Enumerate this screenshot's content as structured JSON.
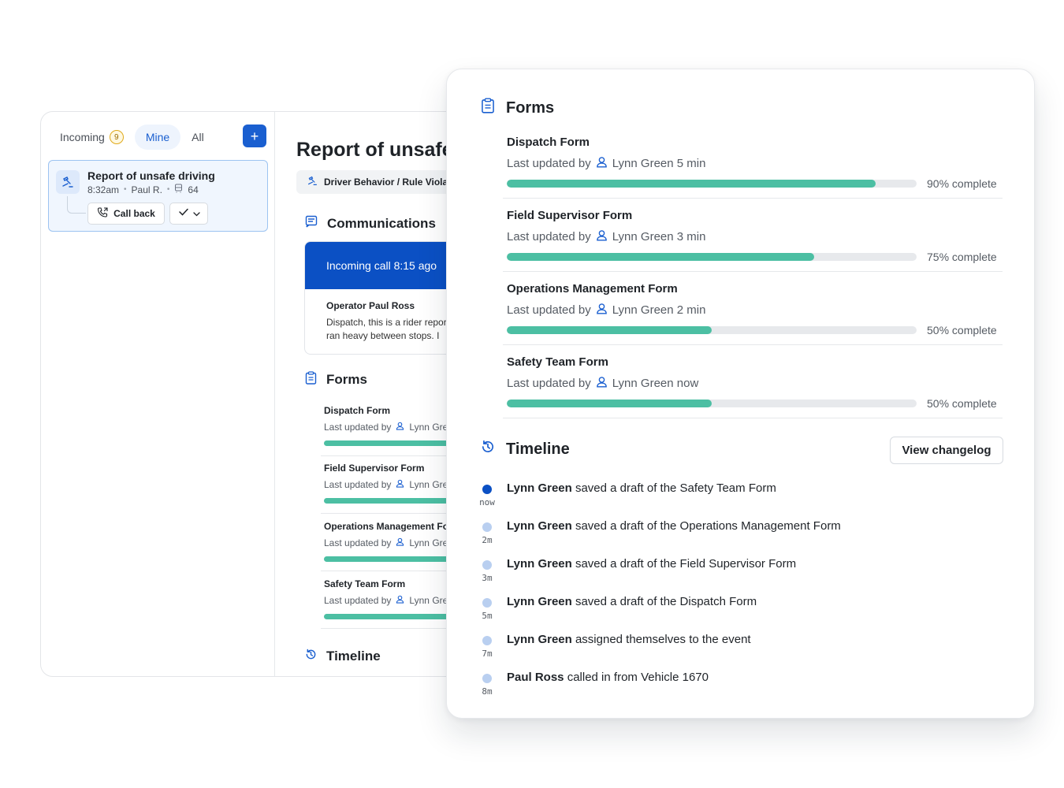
{
  "inbox": {
    "tabs": [
      {
        "label": "Incoming",
        "badge": "9"
      },
      {
        "label": "Mine"
      },
      {
        "label": "All"
      }
    ],
    "add_label": "+",
    "ticket": {
      "title": "Report of unsafe driving",
      "time": "8:32am",
      "operator": "Paul R.",
      "vehicle": "64",
      "callback_label": "Call back"
    }
  },
  "detail": {
    "title": "Report of unsafe driving",
    "category": "Driver Behavior / Rule Violation",
    "communications_heading": "Communications",
    "call_label": "Incoming call 8:15 ago",
    "operator": "Operator Paul Ross",
    "message_line1": "Dispatch, this is a rider report:",
    "message_line2": "ran heavy between stops. I",
    "forms_heading": "Forms",
    "timeline_heading": "Timeline",
    "forms": [
      {
        "name": "Dispatch Form",
        "updated_prefix": "Last updated by",
        "user": "Lynn Green"
      },
      {
        "name": "Field Supervisor Form",
        "updated_prefix": "Last updated by",
        "user": "Lynn Green"
      },
      {
        "name": "Operations Management Form",
        "updated_prefix": "Last updated by",
        "user": "Lynn Green"
      },
      {
        "name": "Safety Team Form",
        "updated_prefix": "Last updated by",
        "user": "Lynn Green"
      }
    ]
  },
  "panel": {
    "forms_heading": "Forms",
    "forms": [
      {
        "name": "Dispatch Form",
        "updated_prefix": "Last updated by",
        "user_time": "Lynn Green 5 min",
        "progress": 0.9,
        "pct_label": "90% complete"
      },
      {
        "name": "Field Supervisor Form",
        "updated_prefix": "Last updated by",
        "user_time": "Lynn Green 3 min",
        "progress": 0.75,
        "pct_label": "75% complete"
      },
      {
        "name": "Operations Management Form",
        "updated_prefix": "Last updated by",
        "user_time": "Lynn Green 2 min",
        "progress": 0.5,
        "pct_label": "50% complete"
      },
      {
        "name": "Safety Team Form",
        "updated_prefix": "Last updated by",
        "user_time": "Lynn Green now",
        "progress": 0.5,
        "pct_label": "50% complete"
      }
    ],
    "timeline_heading": "Timeline",
    "changelog_label": "View changelog",
    "timeline": [
      {
        "actor": "Lynn Green",
        "text": " saved a draft of the Safety Team Form",
        "time": "now",
        "current": true
      },
      {
        "actor": "Lynn Green",
        "text": " saved a draft of the Operations Management Form",
        "time": "2m",
        "current": false
      },
      {
        "actor": "Lynn Green",
        "text": " saved a draft of the Field Supervisor Form",
        "time": "3m",
        "current": false
      },
      {
        "actor": "Lynn Green",
        "text": " saved a draft of the Dispatch Form",
        "time": "5m",
        "current": false
      },
      {
        "actor": "Lynn Green",
        "text": " assigned themselves to the event",
        "time": "7m",
        "current": false
      },
      {
        "actor": "Paul Ross",
        "text": " called in from Vehicle 1670",
        "time": "8m",
        "current": false
      }
    ]
  },
  "colors": {
    "accent": "#0b50c4",
    "progress": "#4cbfa3",
    "track": "#e7e9ec"
  },
  "icons": [
    "gavel-icon",
    "phone-callback-icon",
    "check-icon",
    "chevron-down-icon",
    "message-icon",
    "clipboard-icon",
    "history-icon",
    "user-icon",
    "bus-icon"
  ]
}
